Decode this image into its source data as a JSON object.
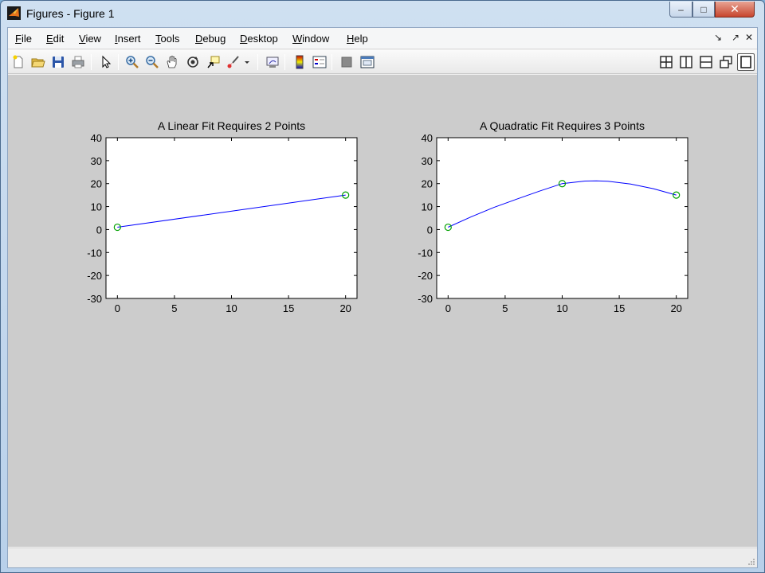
{
  "window": {
    "title": "Figures - Figure 1"
  },
  "title_buttons": {
    "minimize": "–",
    "maximize": "□",
    "close": "✕"
  },
  "menubar": {
    "items": [
      "File",
      "Edit",
      "View",
      "Insert",
      "Tools",
      "Debug",
      "Desktop",
      "Window",
      "Help"
    ],
    "dock_controls": [
      "↘",
      "↗",
      "✕"
    ]
  },
  "toolbar": {
    "left_icons": [
      "new-figure-icon",
      "open-file-icon",
      "save-icon",
      "print-icon",
      "select-arrow-icon",
      "zoom-in-icon",
      "zoom-out-icon",
      "pan-hand-icon",
      "rotate-3d-icon",
      "data-cursor-icon",
      "brush-icon",
      "brush-dropdown-icon",
      "link-plot-icon",
      "insert-colorbar-icon",
      "insert-legend-icon",
      "hide-plot-tools-icon",
      "show-plot-tools-icon"
    ],
    "layout_icons": [
      "tile-grid-icon",
      "tile-columns-icon",
      "tile-rows-icon",
      "float-icon",
      "maximize-icon"
    ]
  },
  "colors": {
    "figure_bg": "#cccccc",
    "line": "#0000ff",
    "marker": "#00a000",
    "axes_bg": "#ffffff"
  },
  "chart_data": [
    {
      "type": "line",
      "title": "A Linear Fit Requires 2 Points",
      "xlabel": "",
      "ylabel": "",
      "xlim": [
        -1,
        21
      ],
      "ylim": [
        -30,
        40
      ],
      "xticks": [
        0,
        5,
        10,
        15,
        20
      ],
      "yticks": [
        40,
        30,
        20,
        10,
        0,
        -10,
        -20,
        -30
      ],
      "grid": false,
      "series": [
        {
          "style": "line",
          "color": "#0000ff",
          "x": [
            0,
            20
          ],
          "y": [
            1,
            15
          ]
        },
        {
          "style": "markers-circle",
          "color": "#00a000",
          "x": [
            0,
            20
          ],
          "y": [
            1,
            15
          ]
        }
      ]
    },
    {
      "type": "line",
      "title": "A Quadratic Fit Requires 3 Points",
      "xlabel": "",
      "ylabel": "",
      "xlim": [
        -1,
        21
      ],
      "ylim": [
        -30,
        40
      ],
      "xticks": [
        0,
        5,
        10,
        15,
        20
      ],
      "yticks": [
        40,
        30,
        20,
        10,
        0,
        -10,
        -20,
        -30
      ],
      "grid": false,
      "series": [
        {
          "style": "line",
          "color": "#0000ff",
          "x": [
            0,
            2,
            4,
            6,
            8,
            10,
            12,
            13,
            14,
            16,
            18,
            20
          ],
          "y": [
            1,
            5.5,
            9.6,
            13.2,
            16.7,
            20,
            21.1,
            21.2,
            21.0,
            19.8,
            17.8,
            15
          ]
        },
        {
          "style": "markers-circle",
          "color": "#00a000",
          "x": [
            0,
            10,
            20
          ],
          "y": [
            1,
            20,
            15
          ]
        }
      ]
    }
  ]
}
